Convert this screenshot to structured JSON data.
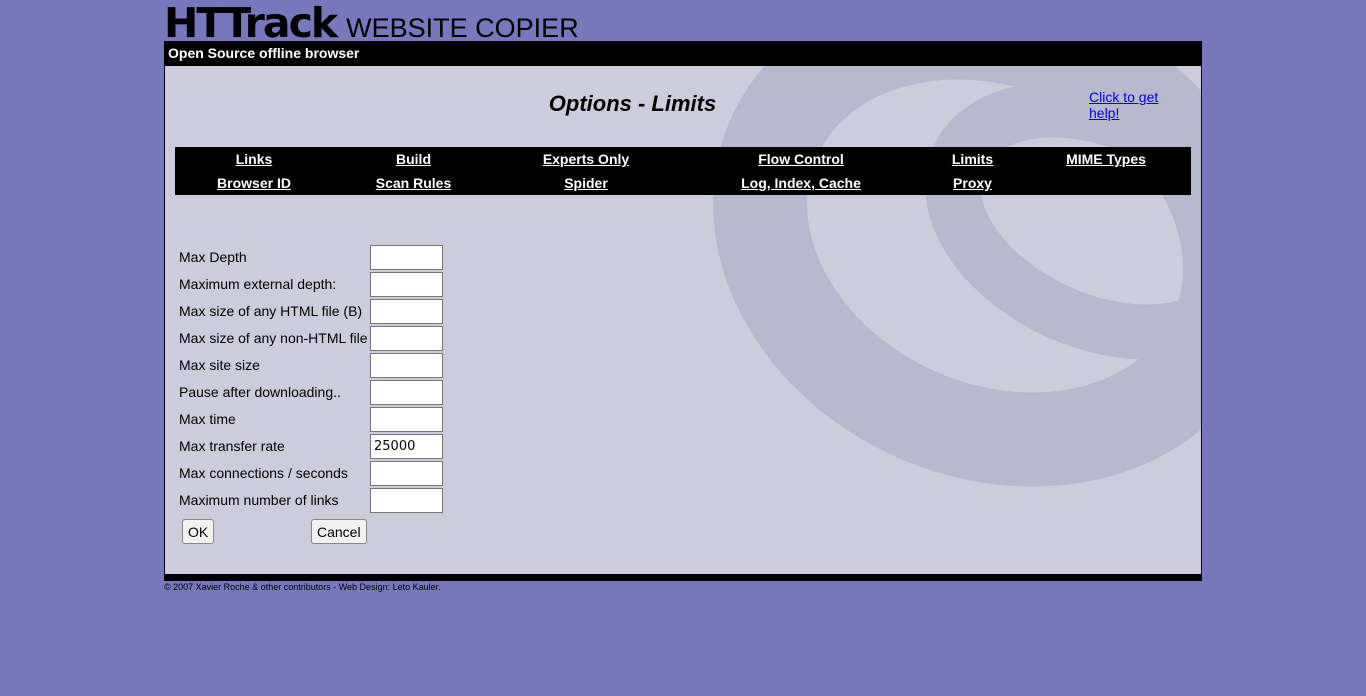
{
  "logo": {
    "main": "HTTrack",
    "sub": "WEBSITE COPIER"
  },
  "topbar": {
    "text": "Open Source offline browser"
  },
  "page": {
    "title": "Options - Limits",
    "help_link": "Click to get help!"
  },
  "nav": {
    "row1": [
      "Links",
      "Build",
      "Experts Only",
      "Flow Control",
      "Limits",
      "MIME Types"
    ],
    "row2": [
      "Browser ID",
      "Scan Rules",
      "Spider",
      "Log, Index, Cache",
      "Proxy",
      ""
    ]
  },
  "fields": [
    {
      "label": "Max Depth",
      "value": ""
    },
    {
      "label": "Maximum external depth:",
      "value": ""
    },
    {
      "label": "Max size of any HTML file (B)",
      "value": ""
    },
    {
      "label": "Max size of any non-HTML file",
      "value": ""
    },
    {
      "label": "Max site size",
      "value": ""
    },
    {
      "label": "Pause after downloading..",
      "value": ""
    },
    {
      "label": "Max time",
      "value": ""
    },
    {
      "label": "Max transfer rate",
      "value": "25000"
    },
    {
      "label": "Max connections / seconds",
      "value": ""
    },
    {
      "label": "Maximum number of links",
      "value": ""
    }
  ],
  "buttons": {
    "ok": "OK",
    "cancel": "Cancel"
  },
  "footer": {
    "text": "© 2007 Xavier Roche & other contributors - Web Design: Leto Kauler."
  },
  "colors": {
    "page_bg": "#7777bb",
    "content_bg": "#ccccdd",
    "swirl": "#b8b8cf",
    "nav_bg": "#000000",
    "link": "#0000ee"
  }
}
